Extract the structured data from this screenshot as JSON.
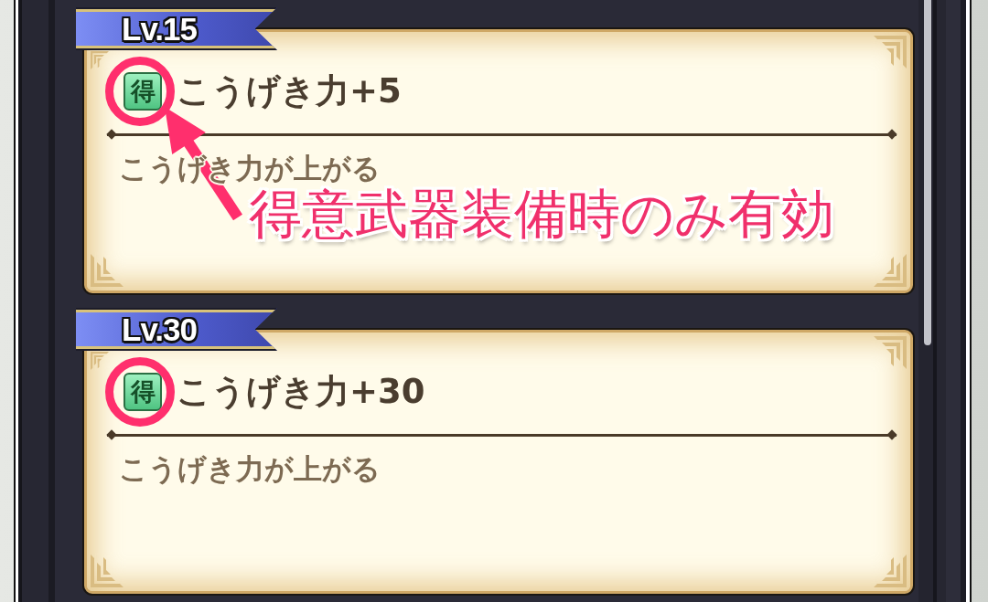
{
  "skills": [
    {
      "level": "Lv.15",
      "tag": "得",
      "title": "こうげき力+5",
      "description": "こうげき力が上がる",
      "highlighted": true
    },
    {
      "level": "Lv.30",
      "tag": "得",
      "title": "こうげき力+30",
      "description": "こうげき力が上がる",
      "highlighted": true
    }
  ],
  "annotation": {
    "text": "得意武器装備時のみ有効"
  }
}
